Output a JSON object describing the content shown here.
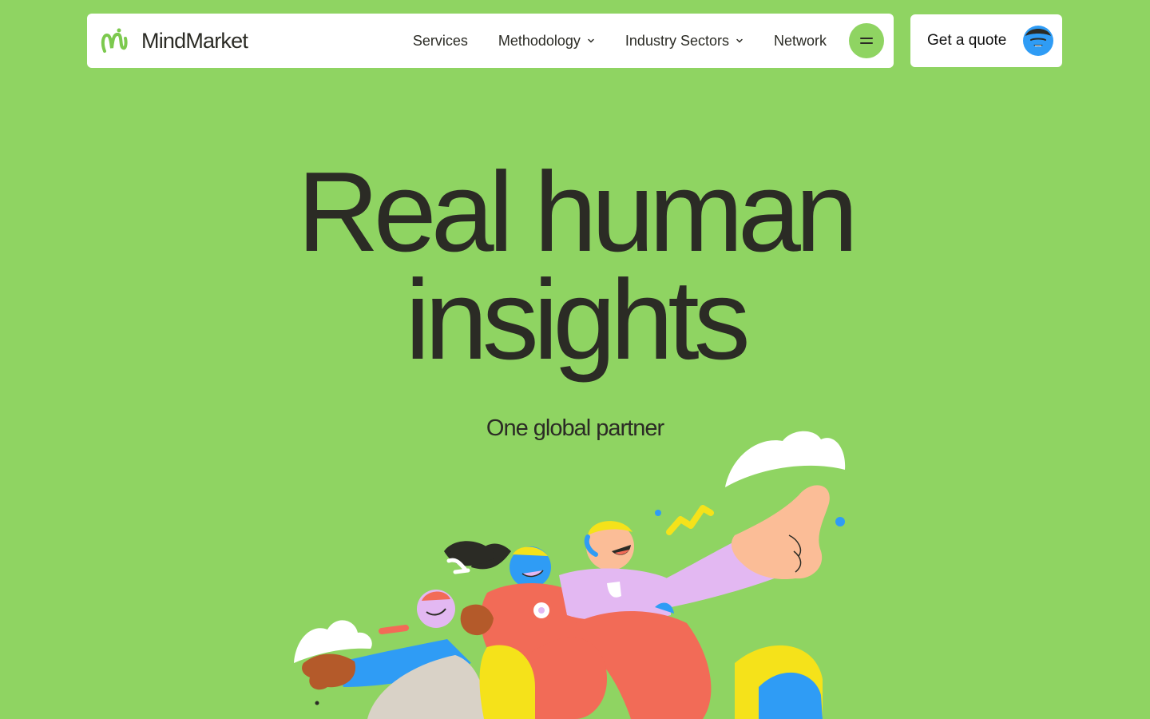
{
  "brand": {
    "name": "MindMarket",
    "logo_icon": "mindmarket-logo-icon",
    "color": "#8fd462"
  },
  "nav": {
    "items": [
      {
        "label": "Services",
        "has_dropdown": false
      },
      {
        "label": "Methodology",
        "has_dropdown": true
      },
      {
        "label": "Industry Sectors",
        "has_dropdown": true
      },
      {
        "label": "Network",
        "has_dropdown": false
      }
    ],
    "menu_icon": "menu-icon"
  },
  "cta": {
    "label": "Get a quote",
    "avatar_icon": "avatar-icon"
  },
  "hero": {
    "title_line1": "Real human",
    "title_line2": "insights",
    "subtitle": "One global partner"
  },
  "colors": {
    "background": "#8fd462",
    "surface": "#ffffff",
    "text": "#2b2b25",
    "accent_blue": "#2f9cf5",
    "accent_coral": "#f26b57",
    "accent_yellow": "#f5e21a",
    "accent_lilac": "#e3b8f2",
    "accent_peach": "#fbbd97"
  }
}
